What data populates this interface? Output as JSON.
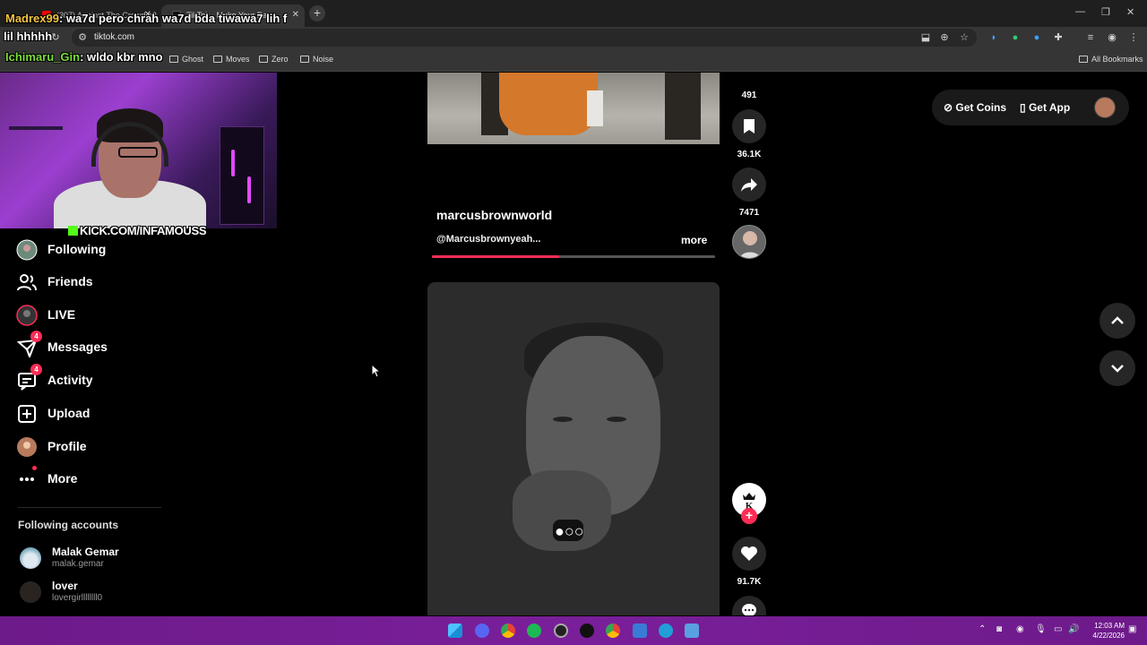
{
  "browser": {
    "tabs": [
      {
        "title": "(307) Against The Crowd o2...",
        "active": false
      },
      {
        "title": "TikTok - Make Your Day",
        "active": true
      }
    ],
    "url": "tiktok.com",
    "bookmarks": [
      "Ghost",
      "Moves",
      "Zero",
      "Noise"
    ],
    "all_bookmarks": "All Bookmarks"
  },
  "stream_overlay": {
    "chat": [
      {
        "user": "Madrex99",
        "message": ": wa7d pero chrah wa7d bda tiwawa7 lih f"
      },
      {
        "user": "",
        "message": "lil hhhhh"
      },
      {
        "user": "Ichimaru_Gin",
        "message": ": wldo kbr mno"
      }
    ],
    "kick_tag": "KICK.COM/INFAMOUSS"
  },
  "sidebar": {
    "nav": [
      {
        "label": "Following",
        "icon": "following-avatar-icon",
        "badge": ""
      },
      {
        "label": "Friends",
        "icon": "friends-icon",
        "badge": ""
      },
      {
        "label": "LIVE",
        "icon": "live-icon",
        "badge": ""
      },
      {
        "label": "Messages",
        "icon": "messages-icon",
        "badge": "4"
      },
      {
        "label": "Activity",
        "icon": "activity-icon",
        "badge": "4"
      },
      {
        "label": "Upload",
        "icon": "upload-icon",
        "badge": ""
      },
      {
        "label": "Profile",
        "icon": "profile-avatar-icon",
        "badge": ""
      },
      {
        "label": "More",
        "icon": "more-icon",
        "badge": "dot"
      }
    ],
    "following_title": "Following accounts",
    "accounts": [
      {
        "name": "Malak Gemar",
        "username": "malak.gemar"
      },
      {
        "name": "lover",
        "username": "lovergirllllllll0"
      }
    ]
  },
  "feed": {
    "video1": {
      "author": "marcusbrownworld",
      "description": "@Marcusbrownyeah...",
      "more_label": "more",
      "progress": 0.45,
      "counts": {
        "comments": "491",
        "saves": "36.1K",
        "shares": "7471"
      }
    },
    "video2": {
      "counts": {
        "likes": "91.7K"
      }
    }
  },
  "header": {
    "get_coins": "Get Coins",
    "get_app": "Get App"
  },
  "taskbar": {
    "time": "12:03 AM",
    "date": "4/22/2026"
  },
  "colors": {
    "accent": "#fe2c55",
    "taskbar": "#7a1f9a",
    "kick_green": "#53fc18"
  }
}
